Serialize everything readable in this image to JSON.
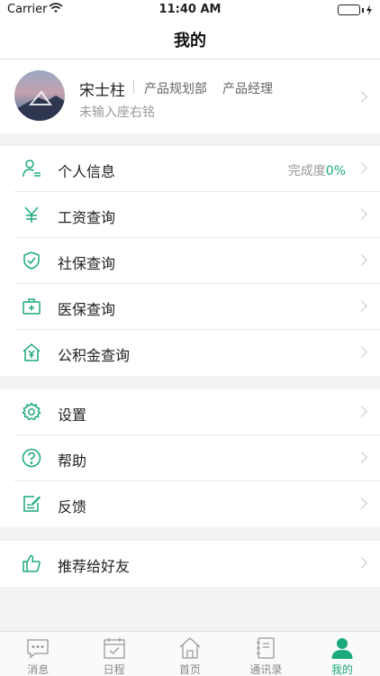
{
  "status_bar": {
    "carrier": "Carrier",
    "time": "11:40 AM"
  },
  "nav": {
    "title": "我的"
  },
  "profile": {
    "name": "宋士柱",
    "department": "产品规划部",
    "role": "产品经理",
    "motto": "未输入座右铭"
  },
  "groups": {
    "info": [
      {
        "label": "个人信息",
        "icon": "person-list-icon",
        "extra_label": "完成度",
        "extra_value": "0%"
      },
      {
        "label": "工资查询",
        "icon": "yen-icon"
      },
      {
        "label": "社保查询",
        "icon": "shield-check-icon"
      },
      {
        "label": "医保查询",
        "icon": "medical-kit-icon"
      },
      {
        "label": "公积金查询",
        "icon": "house-yen-icon"
      }
    ],
    "system": [
      {
        "label": "设置",
        "icon": "gear-icon"
      },
      {
        "label": "帮助",
        "icon": "question-icon"
      },
      {
        "label": "反馈",
        "icon": "feedback-edit-icon"
      }
    ],
    "share": [
      {
        "label": "推荐给好友",
        "icon": "thumbs-up-icon"
      }
    ]
  },
  "tabs": [
    {
      "label": "消息",
      "icon": "message-icon"
    },
    {
      "label": "日程",
      "icon": "calendar-icon"
    },
    {
      "label": "首页",
      "icon": "home-icon"
    },
    {
      "label": "通讯录",
      "icon": "contacts-icon"
    },
    {
      "label": "我的",
      "icon": "profile-icon"
    }
  ],
  "colors": {
    "accent": "#1aa87c",
    "background": "#f2f2f4",
    "tab_inactive": "#888888"
  }
}
